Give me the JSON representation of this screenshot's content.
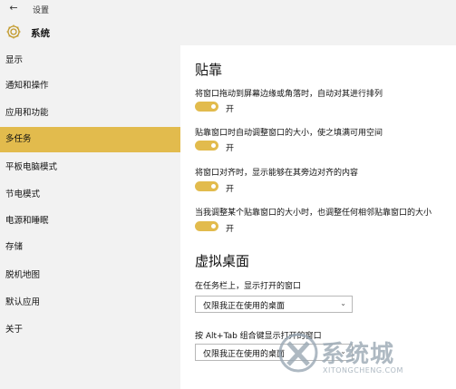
{
  "titlebar": {
    "back_icon": "back-arrow-icon",
    "title": "设置"
  },
  "header": {
    "icon": "gear-icon",
    "title": "系统"
  },
  "sidebar": {
    "items": [
      {
        "label": "显示"
      },
      {
        "label": "通知和操作"
      },
      {
        "label": "应用和功能"
      },
      {
        "label": "多任务",
        "active": true
      },
      {
        "label": "平板电脑模式"
      },
      {
        "label": "节电模式"
      },
      {
        "label": "电源和睡眠"
      },
      {
        "label": "存储"
      },
      {
        "label": "脱机地图"
      },
      {
        "label": "默认应用"
      },
      {
        "label": "关于"
      }
    ]
  },
  "snap": {
    "heading": "贴靠",
    "settings": [
      {
        "description": "将窗口拖动到屏幕边缘或角落时，自动对其进行排列",
        "state": "开"
      },
      {
        "description": "贴靠窗口时自动调整窗口的大小，使之填满可用空间",
        "state": "开"
      },
      {
        "description": "将窗口对齐时，显示能够在其旁边对齐的内容",
        "state": "开"
      },
      {
        "description": "当我调整某个贴靠窗口的大小时，也调整任何相邻贴靠窗口的大小",
        "state": "开"
      }
    ]
  },
  "virtual_desktops": {
    "heading": "虚拟桌面",
    "taskbar_label": "在任务栏上，显示打开的窗口",
    "taskbar_value": "仅限我正在使用的桌面",
    "alttab_label": "按 Alt+Tab 组合键显示打开的窗口",
    "alttab_value": "仅限我正在使用的桌面"
  },
  "watermark": {
    "main": "系统城",
    "sub": "XITONGCHENG.COM"
  },
  "colors": {
    "accent": "#e2bb4d",
    "sidebar_bg": "#f2f2f2"
  }
}
